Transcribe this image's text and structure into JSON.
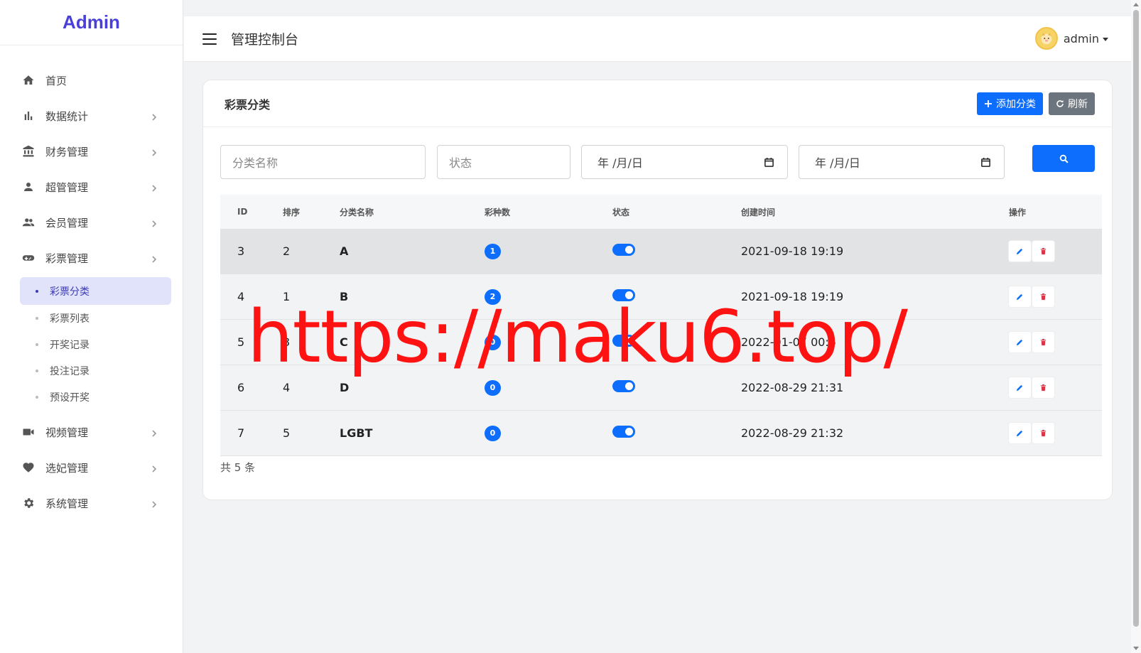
{
  "brand": "Admin",
  "sidebar": {
    "items": [
      {
        "label": "首页",
        "icon": "home-icon"
      },
      {
        "label": "数据统计",
        "icon": "bar-chart-icon"
      },
      {
        "label": "财务管理",
        "icon": "bank-icon"
      },
      {
        "label": "超管管理",
        "icon": "person-icon"
      },
      {
        "label": "会员管理",
        "icon": "people-icon"
      },
      {
        "label": "彩票管理",
        "icon": "gamepad-icon"
      },
      {
        "label": "视频管理",
        "icon": "video-camera-icon"
      },
      {
        "label": "选妃管理",
        "icon": "heart-icon"
      },
      {
        "label": "系统管理",
        "icon": "gear-icon"
      }
    ],
    "submenu": [
      {
        "label": "彩票分类",
        "active": true
      },
      {
        "label": "彩票列表",
        "active": false
      },
      {
        "label": "开奖记录",
        "active": false
      },
      {
        "label": "投注记录",
        "active": false
      },
      {
        "label": "预设开奖",
        "active": false
      }
    ]
  },
  "header": {
    "title": "管理控制台",
    "user": "admin"
  },
  "card": {
    "title": "彩票分类",
    "add_label": "添加分类",
    "refresh_label": "刷新"
  },
  "filters": {
    "name_placeholder": "分类名称",
    "status_placeholder": "状态",
    "date_start": "年 /月/日",
    "date_end": "年 /月/日"
  },
  "table": {
    "columns": [
      "ID",
      "排序",
      "分类名称",
      "彩种数",
      "状态",
      "创建时间",
      "操作"
    ],
    "rows": [
      {
        "id": "3",
        "sort": "2",
        "name": "A",
        "count": "1",
        "status": true,
        "created": "2021-09-18 19:19"
      },
      {
        "id": "4",
        "sort": "1",
        "name": "B",
        "count": "2",
        "status": true,
        "created": "2021-09-18 19:19"
      },
      {
        "id": "5",
        "sort": "3",
        "name": "C",
        "count": "0",
        "status": true,
        "created": "2022-01-07 00:5"
      },
      {
        "id": "6",
        "sort": "4",
        "name": "D",
        "count": "0",
        "status": true,
        "created": "2022-08-29 21:31"
      },
      {
        "id": "7",
        "sort": "5",
        "name": "LGBT",
        "count": "0",
        "status": true,
        "created": "2022-08-29 21:32"
      }
    ],
    "total": "共 5 条"
  },
  "watermark": "https://maku6.top/",
  "colors": {
    "brand": "#4a3fd6",
    "primary": "#0d6efd",
    "danger": "#dc3545",
    "secondary": "#6c757d",
    "watermark": "#ff1212"
  }
}
